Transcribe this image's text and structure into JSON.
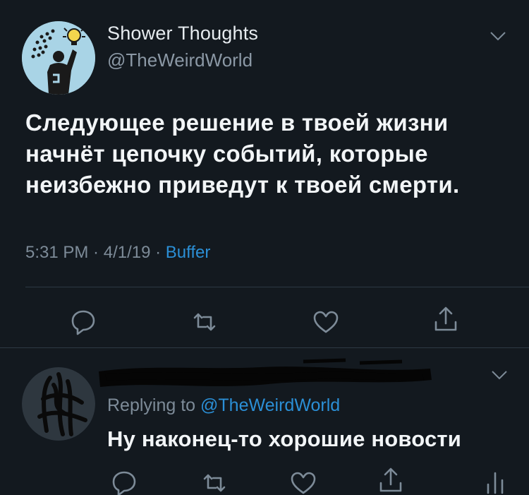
{
  "tweet": {
    "author_name": "Shower Thoughts",
    "author_handle": "@TheWeirdWorld",
    "text": "Следующее решение в твоей жизни начнёт цепочку событий, которые неизбежно приведут к твоей смерти.",
    "time": "5:31 PM",
    "separator": " · ",
    "date": "4/1/19",
    "source": "Buffer",
    "actions": [
      "reply-icon",
      "retweet-icon",
      "like-icon",
      "share-icon"
    ]
  },
  "reply": {
    "replying_prefix": "Replying to ",
    "replying_to": "@TheWeirdWorld",
    "text": "Ну наконец-то хорошие новости",
    "actions": [
      "reply-icon",
      "retweet-icon",
      "like-icon",
      "share-icon",
      "analytics-icon"
    ]
  },
  "colors": {
    "background": "#13191f",
    "text": "#f2f5f7",
    "muted": "#7d8b98",
    "link": "#2b8fd6"
  }
}
